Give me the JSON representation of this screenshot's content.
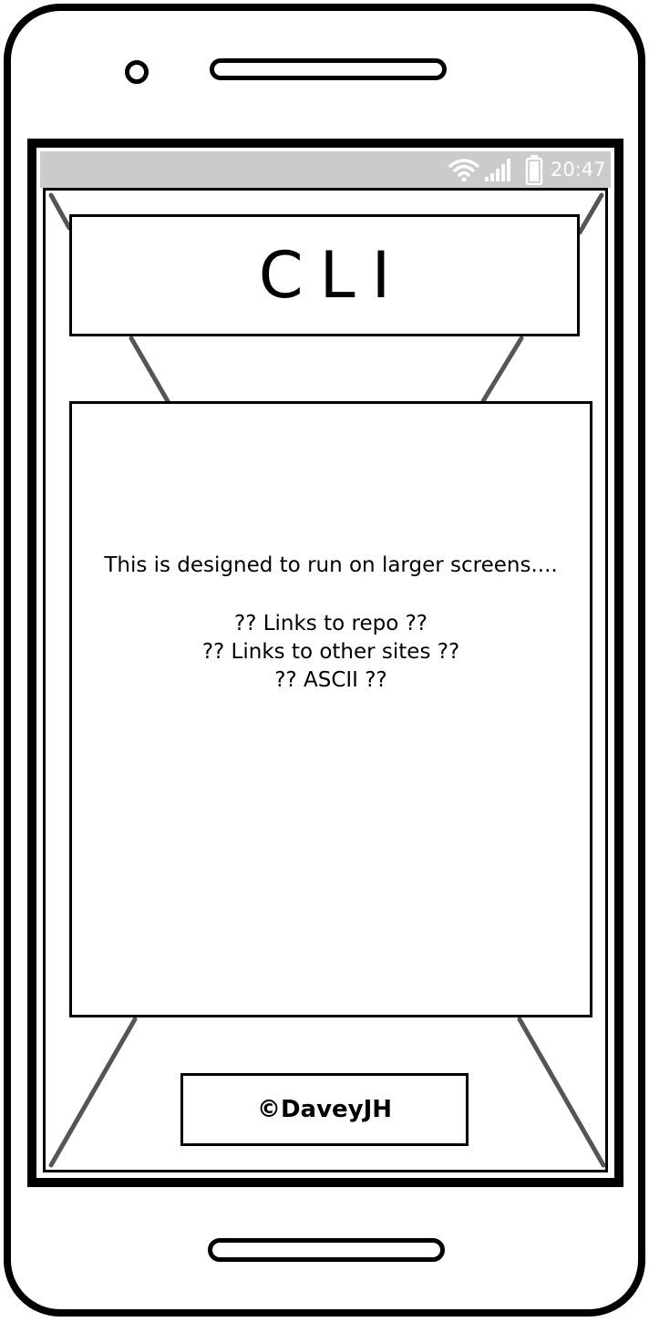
{
  "status_bar": {
    "time": "20:47",
    "icons": [
      "wifi-icon",
      "signal-icon",
      "battery-icon"
    ]
  },
  "header": {
    "title": "CLI"
  },
  "main": {
    "lines": [
      "This is designed to run on larger screens....",
      "?? Links to repo ??",
      "?? Links to other sites ??",
      "?? ASCII ??"
    ]
  },
  "footer": {
    "text": "©DaveyJH"
  },
  "colors": {
    "status_bar": "#cbcbcb",
    "frame": "#000000",
    "guide_lines": "#555555"
  }
}
